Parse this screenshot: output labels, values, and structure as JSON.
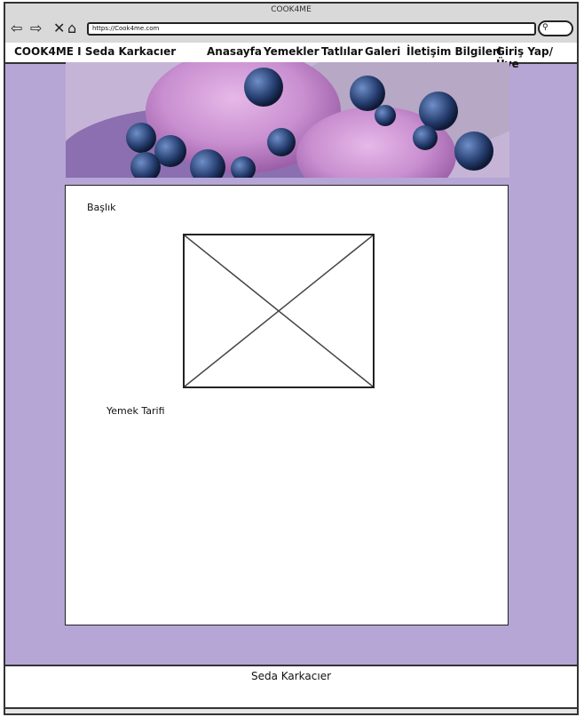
{
  "window": {
    "title": "COOK4ME"
  },
  "browser": {
    "url": "https://Cook4me.com",
    "icons": [
      "back-arrow-icon",
      "forward-arrow-icon",
      "close-x-icon",
      "home-icon",
      "search-icon"
    ]
  },
  "nav": {
    "brand": "COOK4ME I Seda Karkacıer",
    "items": [
      "Anasayfa",
      "Yemekler",
      "Tatlılar",
      "Galeri",
      "İletişim Bilgileri",
      "Giriş Yap/ Üye"
    ]
  },
  "content": {
    "heading": "Başlık",
    "recipe_label": "Yemek Tarifi"
  },
  "footer": {
    "text": "Seda Karkacıer"
  },
  "colors": {
    "page_bg": "#b5a6d6",
    "accent": "#b5a6d6"
  }
}
